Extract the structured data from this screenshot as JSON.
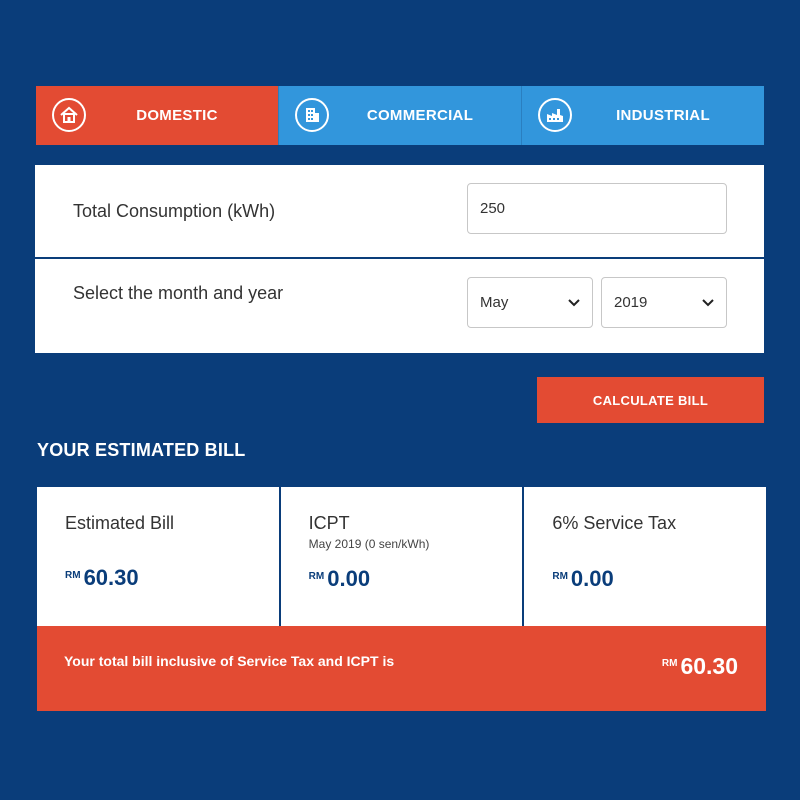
{
  "tabs": [
    {
      "label": "DOMESTIC",
      "icon": "house-icon",
      "active": true
    },
    {
      "label": "COMMERCIAL",
      "icon": "building-icon",
      "active": false
    },
    {
      "label": "INDUSTRIAL",
      "icon": "factory-icon",
      "active": false
    }
  ],
  "form": {
    "consumption_label": "Total Consumption (kWh)",
    "consumption_value": "250",
    "period_label": "Select the month and year",
    "month_value": "May",
    "year_value": "2019"
  },
  "calculate_label": "CALCULATE BILL",
  "section_title": "YOUR ESTIMATED BILL",
  "cards": [
    {
      "title": "Estimated Bill",
      "subtitle": "",
      "currency": "RM",
      "amount": "60.30"
    },
    {
      "title": "ICPT",
      "subtitle": "May 2019 (0 sen/kWh)",
      "currency": "RM",
      "amount": "0.00"
    },
    {
      "title": "6% Service Tax",
      "subtitle": "",
      "currency": "RM",
      "amount": "0.00"
    }
  ],
  "total": {
    "text": "Your total bill inclusive of Service Tax and ICPT is",
    "currency": "RM",
    "amount": "60.30"
  },
  "colors": {
    "background": "#0a3d7a",
    "accent": "#e34b33",
    "tab_inactive": "#3296dc"
  }
}
